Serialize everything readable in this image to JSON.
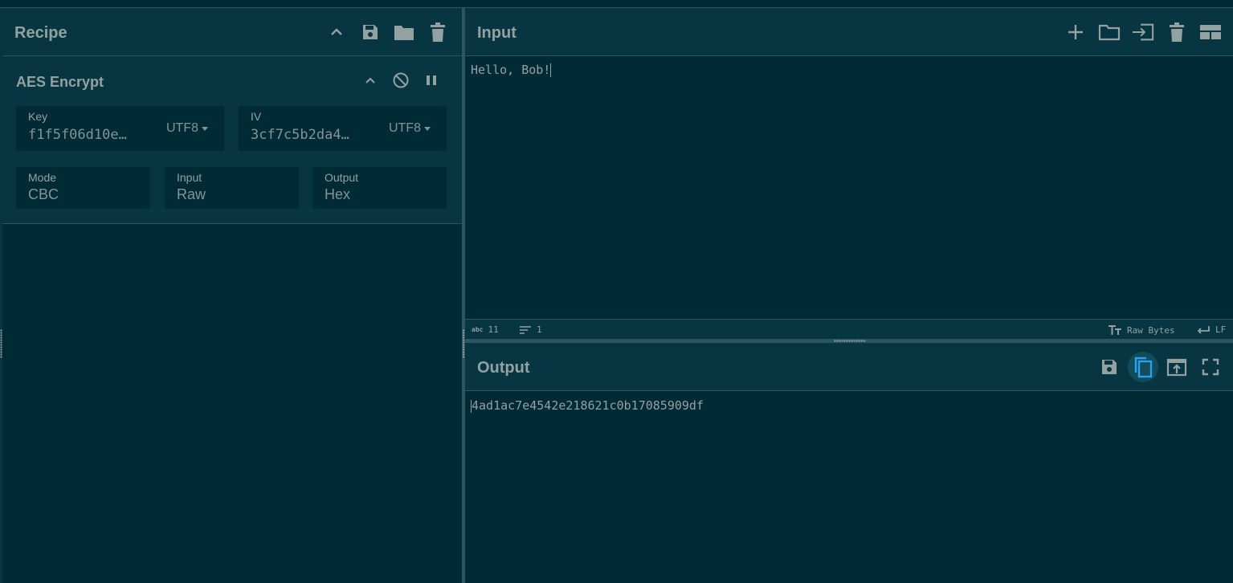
{
  "recipe": {
    "title": "Recipe",
    "icons": [
      "chevron-up-icon",
      "save-icon",
      "folder-icon",
      "trash-icon"
    ],
    "operation": {
      "name": "AES Encrypt",
      "key": {
        "label": "Key",
        "value": "f1f5f06d10e…",
        "encoding": "UTF8"
      },
      "iv": {
        "label": "IV",
        "value": "3cf7c5b2da4…",
        "encoding": "UTF8"
      },
      "mode": {
        "label": "Mode",
        "value": "CBC"
      },
      "input": {
        "label": "Input",
        "value": "Raw"
      },
      "output": {
        "label": "Output",
        "value": "Hex"
      }
    }
  },
  "input": {
    "title": "Input",
    "text": "Hello, Bob!",
    "status": {
      "length_icon": "abc",
      "length": "11",
      "lines": "1",
      "encoding": "Raw Bytes",
      "eol": "LF"
    }
  },
  "output": {
    "title": "Output",
    "text": "4ad1ac7e4542e218621c0b17085909df"
  },
  "colors": {
    "background": "#002b36",
    "panel": "#073642",
    "text": "#93a1a1",
    "accent": "#2aa1f0"
  }
}
